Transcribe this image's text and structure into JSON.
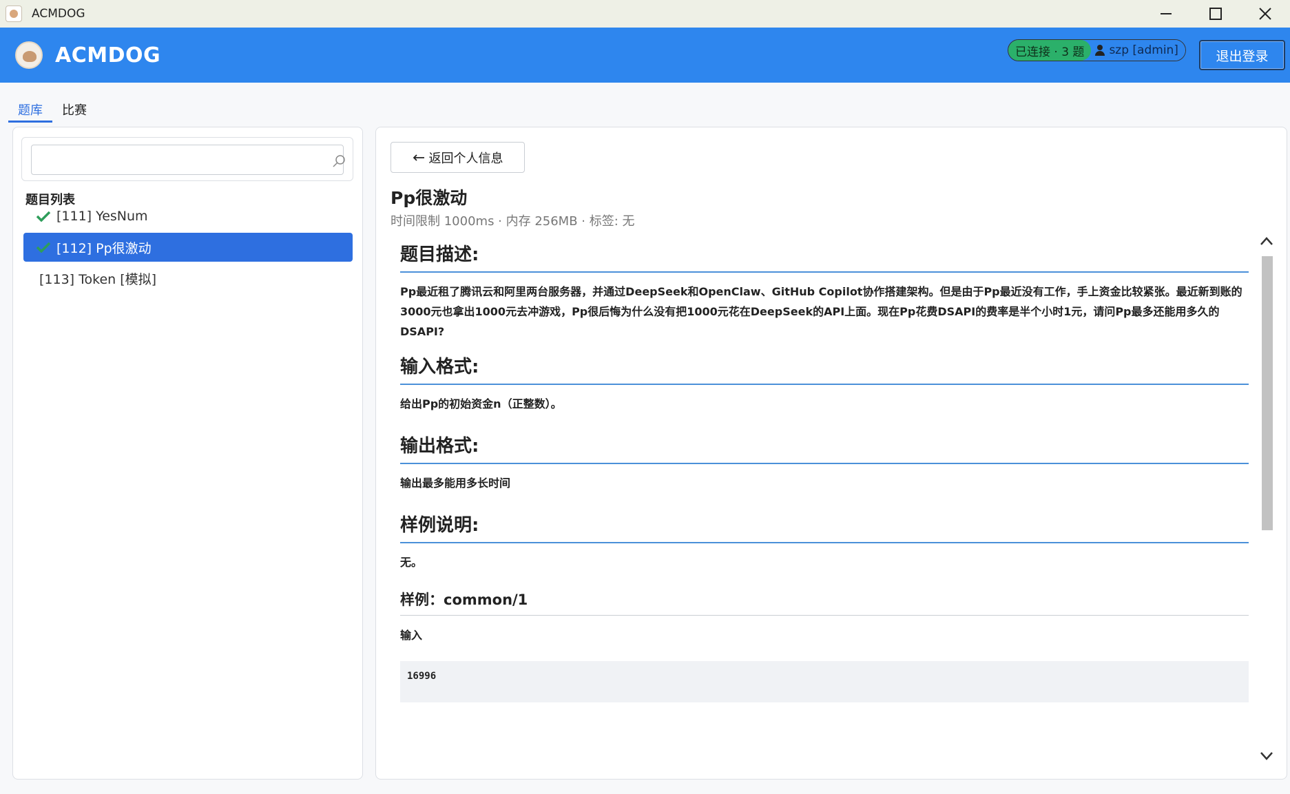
{
  "window": {
    "title": "ACMDOG"
  },
  "header": {
    "brand": "ACMDOG",
    "status": "已连接 · 3 题",
    "user": "szp [admin]",
    "logout_label": "退出登录"
  },
  "tabs": [
    {
      "label": "题库",
      "active": true
    },
    {
      "label": "比赛",
      "active": false
    }
  ],
  "sidebar": {
    "search_value": "",
    "heading": "题目列表",
    "items": [
      {
        "label": "[111] YesNum",
        "solved": true,
        "selected": false
      },
      {
        "label": "[112] Pp很激动",
        "solved": true,
        "selected": true
      },
      {
        "label": "[113] Token  [模拟]",
        "solved": false,
        "selected": false
      }
    ]
  },
  "problem": {
    "back_label": "返回个人信息",
    "title": "Pp很激动",
    "meta": "时间限制 1000ms · 内存 256MB · 标签: 无",
    "sections": {
      "description_h": "题目描述:",
      "description_p": "Pp最近租了腾讯云和阿里两台服务器，并通过DeepSeek和OpenClaw、GitHub Copilot协作搭建架构。但是由于Pp最近没有工作，手上资金比较紧张。最近新到账的3000元也拿出1000元去冲游戏，Pp很后悔为什么没有把1000元花在DeepSeek的API上面。现在Pp花费DSAPI的费率是半个小时1元，请问Pp最多还能用多久的DSAPI?",
      "input_h": "输入格式:",
      "input_p": "给出Pp的初始资金n（正整数）。",
      "output_h": "输出格式:",
      "output_p": "输出最多能用多长时间",
      "sample_note_h": "样例说明:",
      "sample_note_p": "无。",
      "sample_h": "样例：common/1",
      "sample_input_label": "输入",
      "sample_input_value": "16996"
    }
  },
  "colors": {
    "header_bg": "#2e86ee",
    "accent": "#2e6fe0",
    "status_green": "#2bb06a",
    "check_green": "#2e9d5a"
  }
}
